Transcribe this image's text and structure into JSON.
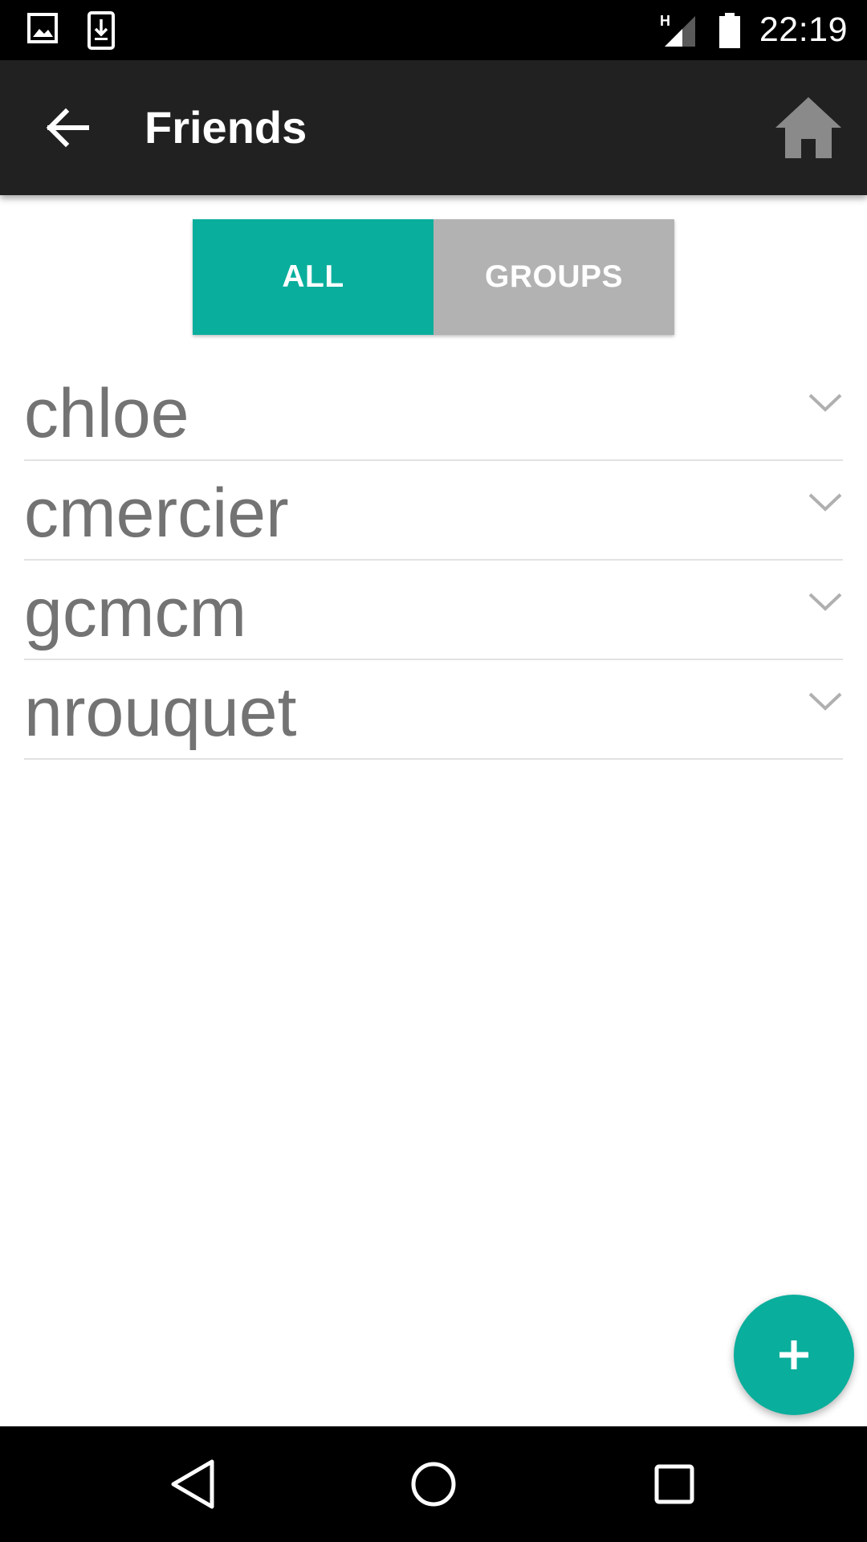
{
  "status_bar": {
    "time": "22:19",
    "network_type": "H",
    "icons": [
      "gallery-notification-icon",
      "download-notification-icon",
      "signal-icon",
      "battery-icon"
    ]
  },
  "app_bar": {
    "title": "Friends",
    "back_icon": "arrow-back-icon",
    "home_icon": "home-icon"
  },
  "tabs": [
    {
      "label": "ALL",
      "active": true
    },
    {
      "label": "GROUPS",
      "active": false
    }
  ],
  "friends": [
    {
      "name": "chloe"
    },
    {
      "name": "cmercier"
    },
    {
      "name": "gcmcm"
    },
    {
      "name": "nrouquet"
    }
  ],
  "fab": {
    "icon": "plus-icon"
  },
  "nav_bar": {
    "icons": [
      "back-nav-icon",
      "home-nav-icon",
      "recents-nav-icon"
    ]
  },
  "colors": {
    "accent": "#0aae9c",
    "app_bar": "#212121",
    "inactive_tab": "#b2b2b2",
    "list_text": "#737373",
    "home_icon": "#8a8a8a"
  }
}
